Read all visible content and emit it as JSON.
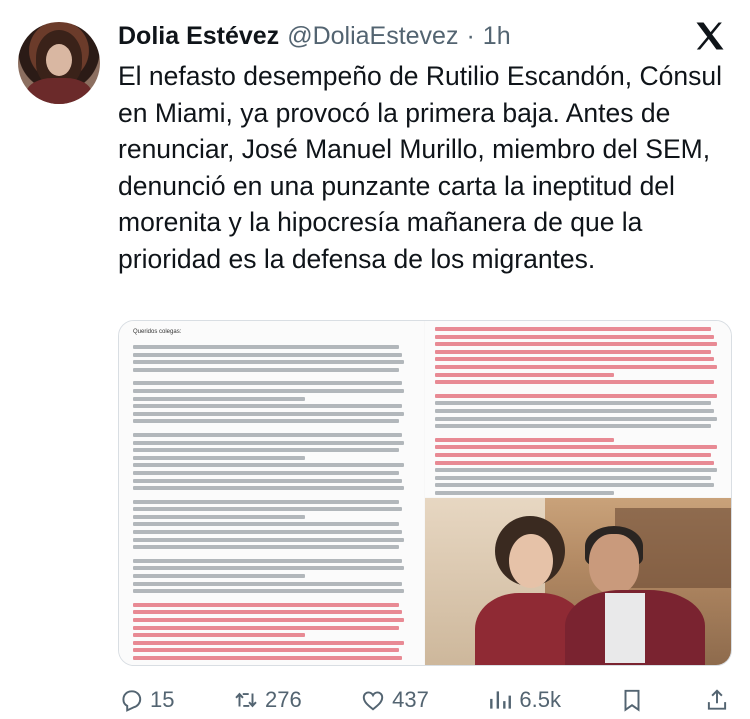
{
  "author": {
    "name": "Dolia Estévez",
    "handle": "@DoliaEstevez",
    "separator": "·",
    "time": "1h"
  },
  "tweet": {
    "text": "El nefasto desempeño de Rutilio Escandón, Cónsul en Miami, ya provocó la primera baja. Antes de renunciar, José Manuel Murillo, miembro del SEM, denunció en una punzante carta la ineptitud del morenita y la hipocresía mañanera de que la prioridad es la defensa de los migrantes."
  },
  "media": {
    "document_greeting": "Queridos colegas:",
    "image_subject": "photo"
  },
  "metrics": {
    "replies": "15",
    "reposts": "276",
    "likes": "437",
    "views": "6.5k"
  },
  "icons": {
    "brand": "x-logo-icon",
    "reply": "reply-icon",
    "repost": "repost-icon",
    "like": "heart-icon",
    "views": "views-icon",
    "bookmark": "bookmark-icon",
    "share": "share-icon"
  },
  "colors": {
    "text": "#0f1419",
    "muted": "#536471",
    "highlight": "#e88a94"
  }
}
